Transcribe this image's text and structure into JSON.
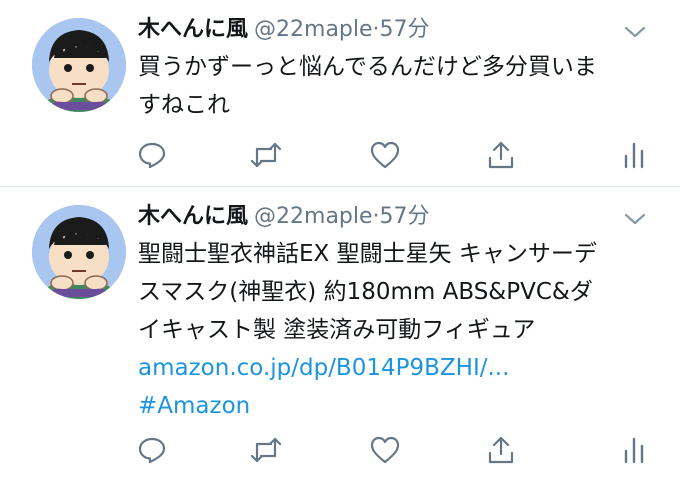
{
  "colors": {
    "link": "#1b95e0",
    "secondary_text": "#657786",
    "primary_text": "#14171a",
    "divider": "#e1e8ed",
    "avatar_bg": "#a9c6f0"
  },
  "tweets": [
    {
      "author_name": "木へんに風",
      "handle": "@22maple",
      "separator": "·",
      "time": "57分",
      "text_lines": [
        "買うかずーっと悩んでるんだけど多分買いま",
        "すねこれ"
      ],
      "actions": [
        "reply-icon",
        "retweet-icon",
        "like-icon",
        "share-icon",
        "analytics-icon"
      ]
    },
    {
      "author_name": "木へんに風",
      "handle": "@22maple",
      "separator": "·",
      "time": "57分",
      "text_lines": [
        "聖闘士聖衣神話EX 聖闘士星矢 キャンサーデ",
        "スマスク(神聖衣) 約180mm ABS&PVC&ダ",
        "イキャスト製 塗装済み可動フィギュア"
      ],
      "link": "amazon.co.jp/dp/B014P9BZHI/...",
      "hashtag": "#Amazon",
      "actions": [
        "reply-icon",
        "retweet-icon",
        "like-icon",
        "share-icon",
        "analytics-icon"
      ]
    }
  ]
}
